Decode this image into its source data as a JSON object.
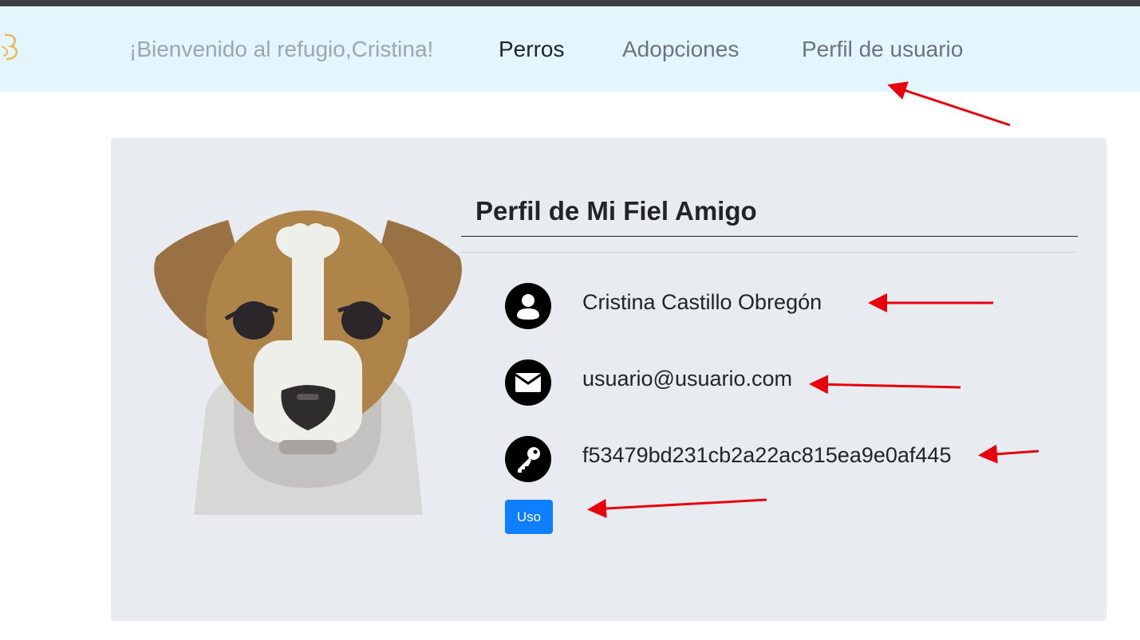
{
  "navbar": {
    "welcome": "¡Bienvenido al refugio,Cristina!",
    "links": [
      "Perros",
      "Adopciones",
      "Perfil de usuario"
    ],
    "background": "#e3f5fd"
  },
  "profile": {
    "title": "Perfil de Mi Fiel Amigo",
    "name": "Cristina Castillo Obregón",
    "email": "usuario@usuario.com",
    "key": "f53479bd231cb2a22ac815ea9e0af445",
    "button_label": "Uso"
  },
  "icons": {
    "name": "user-icon",
    "email": "envelope-icon",
    "key": "key-icon",
    "image": "dog-avatar"
  },
  "colors": {
    "accent": "#0d7fff",
    "card": "#e8ebef",
    "annotation_arrow": "#e8000b"
  }
}
